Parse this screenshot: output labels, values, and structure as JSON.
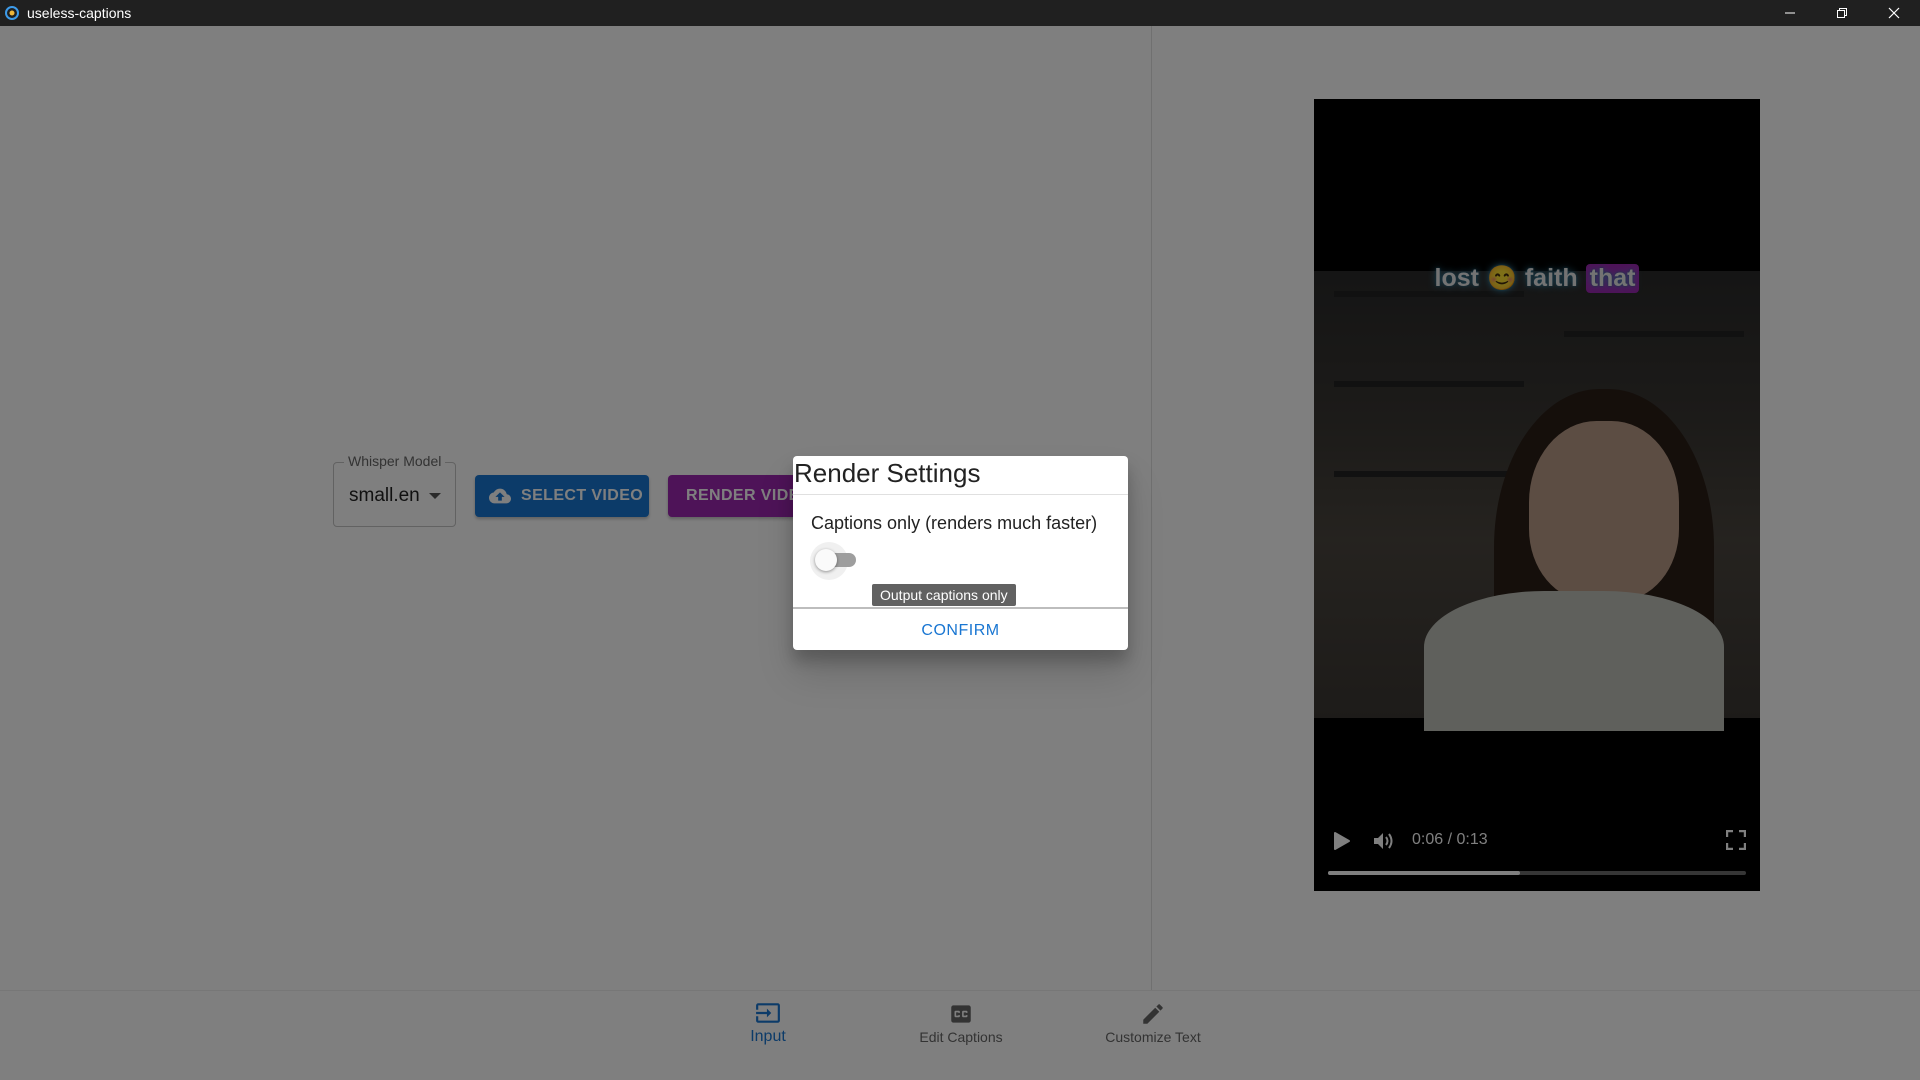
{
  "window": {
    "title": "useless-captions"
  },
  "input_panel": {
    "whisper_label": "Whisper Model",
    "whisper_value": "small.en",
    "select_video_label": "SELECT VIDEO",
    "render_video_label": "RENDER VIDEO"
  },
  "video": {
    "caption_words": [
      "lost",
      "faith",
      "that"
    ],
    "caption_emoji": "😊",
    "time": "0:06 / 0:13",
    "progress_fraction": 0.46
  },
  "dialog": {
    "title": "Render Settings",
    "option_label": "Captions only (renders much faster)",
    "toggle_on": false,
    "tooltip": "Output captions only",
    "confirm_label": "CONFIRM"
  },
  "bottom_nav": {
    "items": [
      {
        "label": "Input",
        "icon": "input-icon",
        "active": true
      },
      {
        "label": "Edit Captions",
        "icon": "closed-caption-icon",
        "active": false
      },
      {
        "label": "Customize Text",
        "icon": "pencil-icon",
        "active": false
      }
    ]
  },
  "colors": {
    "primary": "#1976d2",
    "secondary": "#9c27b0",
    "titlebar": "#202020"
  }
}
